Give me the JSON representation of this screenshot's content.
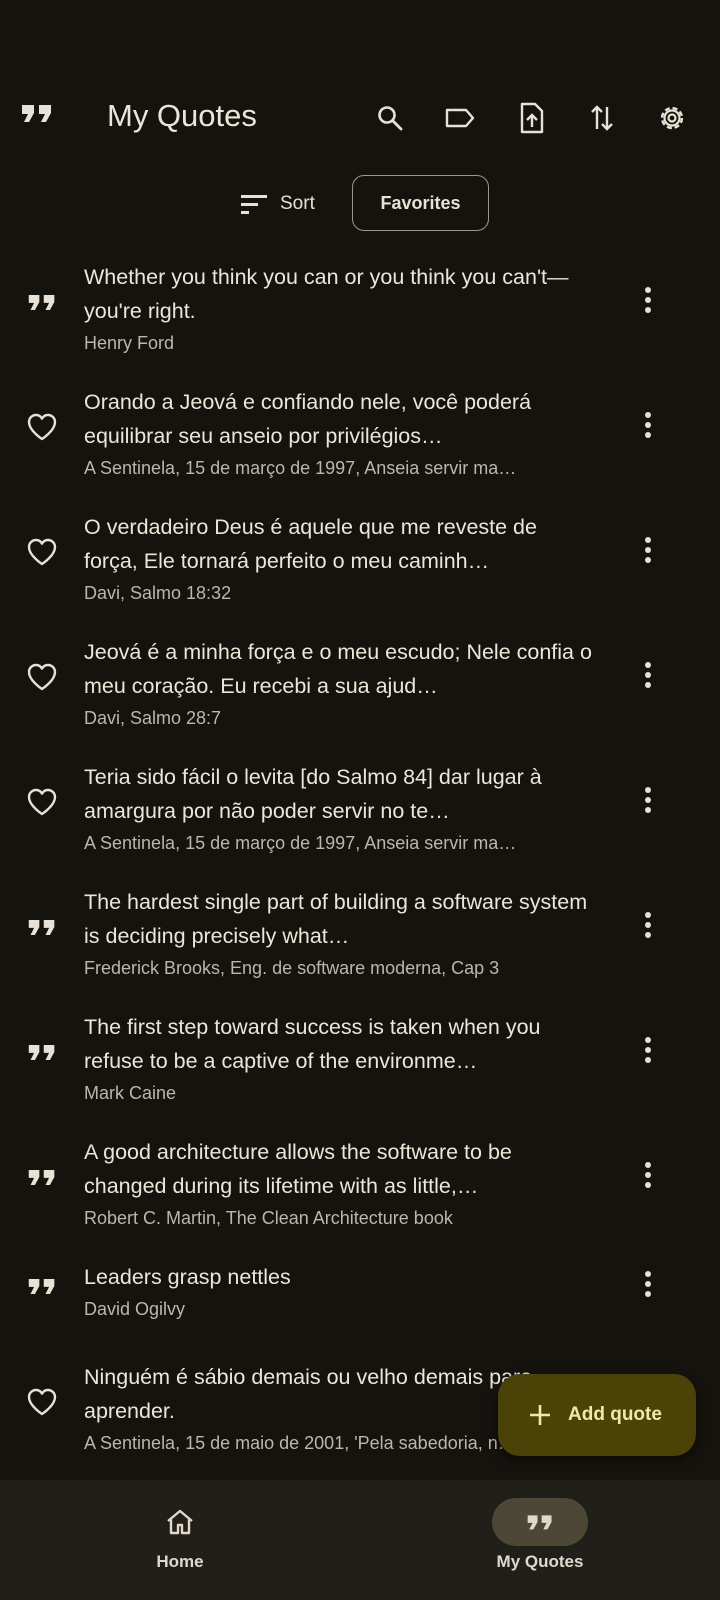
{
  "appbar": {
    "title": "My Quotes",
    "actions": [
      "search-icon",
      "label-icon",
      "export-icon",
      "sort-swap-icon",
      "settings-icon"
    ]
  },
  "filters": {
    "sort_label": "Sort",
    "favorites_label": "Favorites"
  },
  "quotes": [
    {
      "icon": "quote-icon",
      "text": "Whether you think you can or you think you can't—you're right.",
      "author": "Henry Ford"
    },
    {
      "icon": "heart-icon",
      "text": "Orando a Jeová e confiando nele, você poderá equilibrar seu anseio por privilégios…",
      "author": "A Sentinela, 15 de março de 1997, Anseia servir ma…"
    },
    {
      "icon": "heart-icon",
      "text": "O verdadeiro Deus é aquele que me reveste de força, Ele tornará perfeito o meu caminh…",
      "author": "Davi, Salmo 18:32"
    },
    {
      "icon": "heart-icon",
      "text": "Jeová é a minha força e o meu escudo; Nele confia o meu coração. Eu recebi a sua ajud…",
      "author": "Davi, Salmo 28:7"
    },
    {
      "icon": "heart-icon",
      "text": "Teria sido fácil o levita [do Salmo 84] dar lugar à amargura por não poder servir no te…",
      "author": "A Sentinela, 15 de março de 1997, Anseia servir ma…"
    },
    {
      "icon": "quote-icon",
      "text": "The hardest single part of building a software system is deciding precisely what…",
      "author": "Frederick Brooks, Eng. de software moderna, Cap 3"
    },
    {
      "icon": "quote-icon",
      "text": "The first step toward success is taken when you refuse to be a captive of the environme…",
      "author": "Mark Caine"
    },
    {
      "icon": "quote-icon",
      "text": "A good architecture allows the software to be changed during its lifetime with as little,…",
      "author": "Robert C. Martin, The Clean Architecture book"
    },
    {
      "icon": "quote-icon",
      "text": "Leaders grasp nettles",
      "author": "David Ogilvy"
    },
    {
      "icon": "heart-icon",
      "text": "Ninguém é sábio demais ou velho demais para aprender.",
      "author": "A Sentinela, 15 de maio de 2001, 'Pela sabedoria, n…"
    }
  ],
  "fab": {
    "label": "Add quote"
  },
  "bottom_nav": [
    {
      "label": "Home",
      "icon": "home-icon",
      "active": false
    },
    {
      "label": "My Quotes",
      "icon": "quote-icon",
      "active": true
    }
  ],
  "colors": {
    "background": "#15130e",
    "fab": "#4b4208",
    "nav_bar": "#201f19",
    "active_pill": "#4d4735"
  }
}
